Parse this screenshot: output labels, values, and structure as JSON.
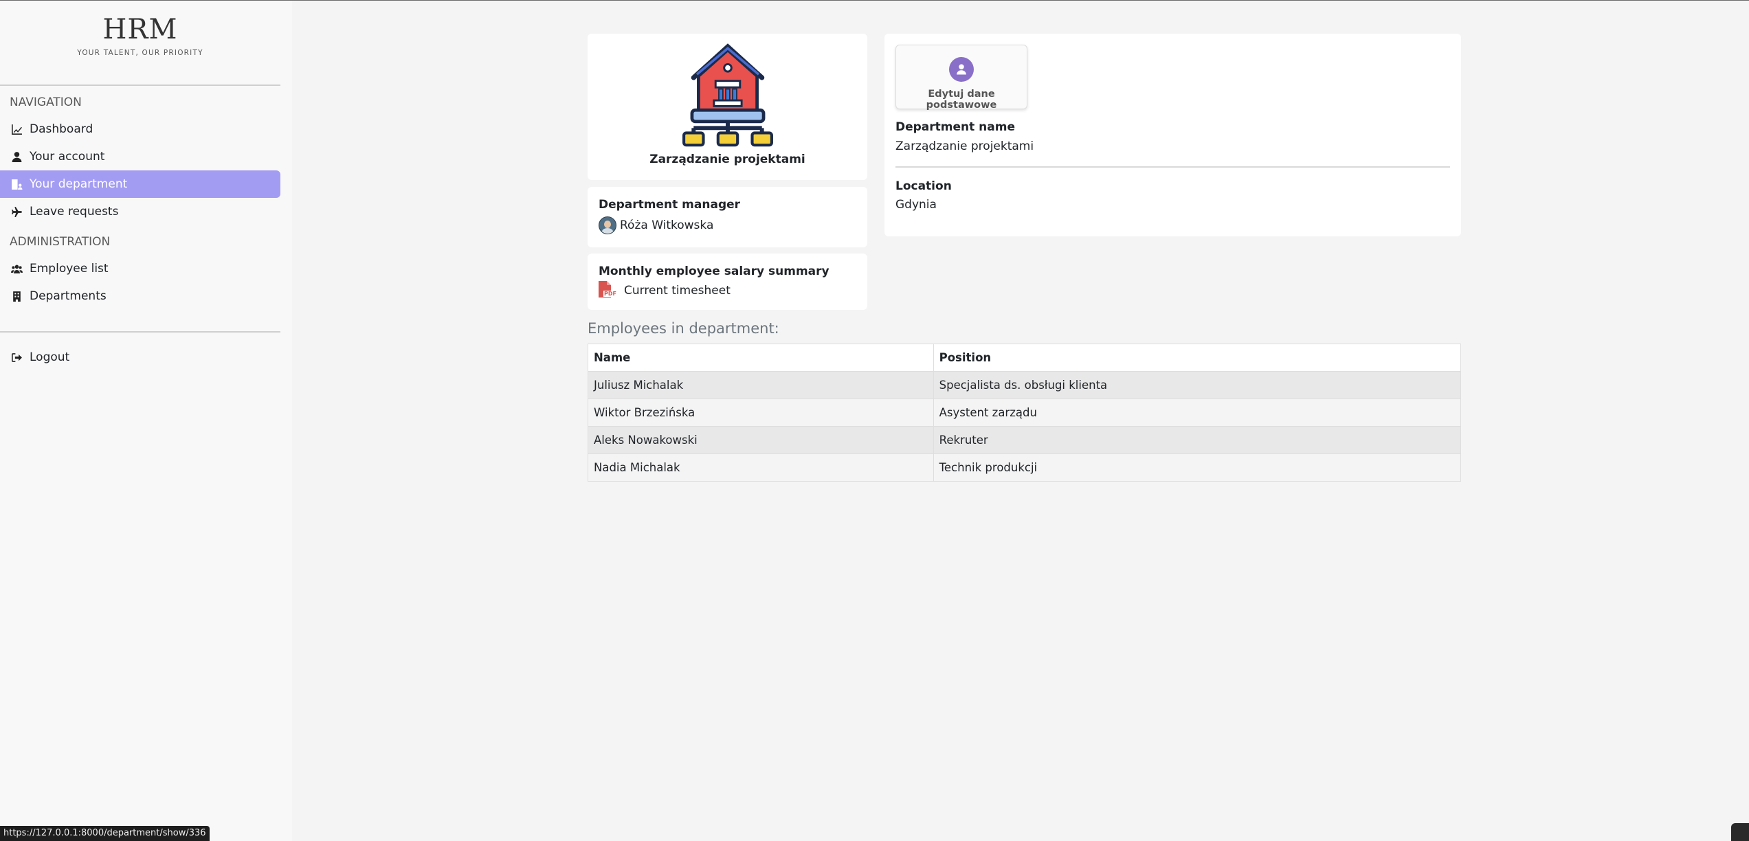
{
  "brand": {
    "title": "HRM",
    "tagline": "YOUR TALENT, OUR PRIORITY"
  },
  "sidebar": {
    "nav_heading": "NAVIGATION",
    "nav_items": [
      {
        "label": "Dashboard",
        "icon": "chart-line-icon"
      },
      {
        "label": "Your account",
        "icon": "user-icon"
      },
      {
        "label": "Your department",
        "icon": "building-user-icon",
        "active": true
      },
      {
        "label": "Leave requests",
        "icon": "plane-icon"
      }
    ],
    "admin_heading": "ADMINISTRATION",
    "admin_items": [
      {
        "label": "Employee list",
        "icon": "users-icon"
      },
      {
        "label": "Departments",
        "icon": "building-icon"
      }
    ],
    "logout_label": "Logout"
  },
  "department": {
    "name_caption": "Zarządzanie projektami",
    "manager_label": "Department manager",
    "manager_name": "Róża Witkowska",
    "salary_label": "Monthly employee salary summary",
    "salary_link": "Current timesheet",
    "pdf_icon_text": "PDF",
    "edit_button": "Edytuj dane podstawowe",
    "field_name_label": "Department name",
    "field_name_value": "Zarządzanie projektami",
    "field_location_label": "Location",
    "field_location_value": "Gdynia"
  },
  "employees": {
    "heading": "Employees in department:",
    "columns": [
      "Name",
      "Position"
    ],
    "rows": [
      [
        "Juliusz Michalak",
        "Specjalista ds. obsługi klienta"
      ],
      [
        "Wiktor Brzezińska",
        "Asystent zarządu"
      ],
      [
        "Aleks Nowakowski",
        "Rekruter"
      ],
      [
        "Nadia Michalak",
        "Technik produkcji"
      ]
    ]
  },
  "status_bar": {
    "url": "https://127.0.0.1:8000/department/show/336"
  },
  "colors": {
    "accent": "#a39cf3",
    "avatar": "#8a6fc8",
    "pdf": "#d9534f"
  }
}
